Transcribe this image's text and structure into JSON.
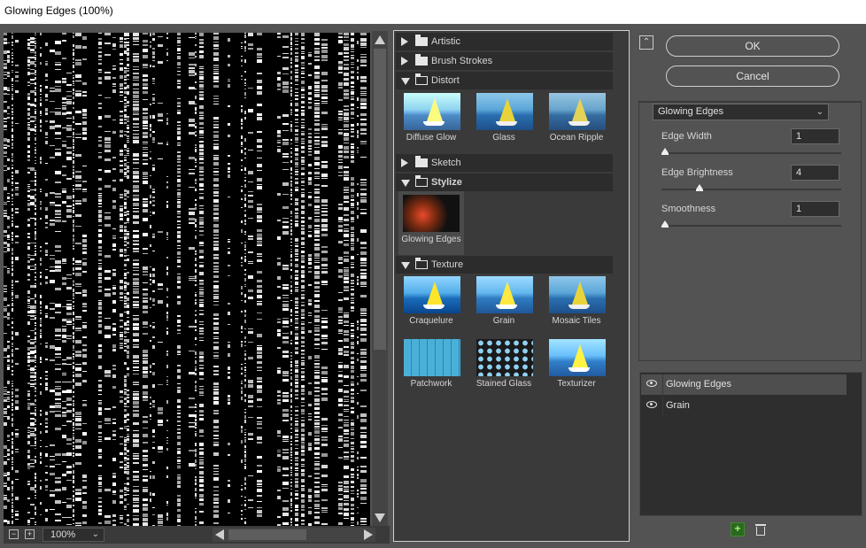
{
  "window": {
    "title": "Glowing Edges (100%)"
  },
  "preview": {
    "zoom": "100%",
    "zoom_out_icon": "minus-square",
    "zoom_in_icon": "plus-square"
  },
  "gallery": {
    "categories": {
      "artistic": "Artistic",
      "brush_strokes": "Brush Strokes",
      "distort": "Distort",
      "sketch": "Sketch",
      "stylize": "Stylize",
      "texture": "Texture"
    },
    "distort_filters": [
      "Diffuse Glow",
      "Glass",
      "Ocean Ripple"
    ],
    "stylize_filters": [
      "Glowing Edges"
    ],
    "texture_filters": [
      "Craquelure",
      "Grain",
      "Mosaic Tiles",
      "Patchwork",
      "Stained Glass",
      "Texturizer"
    ]
  },
  "buttons": {
    "ok": "OK",
    "cancel": "Cancel"
  },
  "settings": {
    "filter": "Glowing Edges",
    "params": [
      {
        "label": "Edge Width",
        "value": "1",
        "fraction": 0.0
      },
      {
        "label": "Edge Brightness",
        "value": "4",
        "fraction": 0.2
      },
      {
        "label": "Smoothness",
        "value": "1",
        "fraction": 0.0
      }
    ]
  },
  "layers": [
    {
      "name": "Glowing Edges",
      "active": true
    },
    {
      "name": "Grain",
      "active": false
    }
  ],
  "colors": {
    "panel": "#535353",
    "dark": "#2e2e2e",
    "accent_new": "#2b6a1e"
  }
}
